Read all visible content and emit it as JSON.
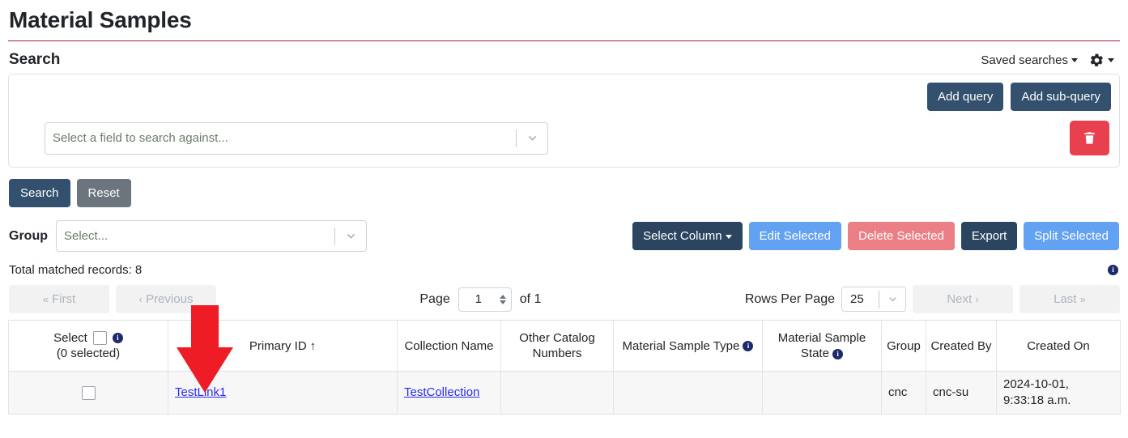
{
  "header": {
    "title": "Material Samples"
  },
  "search": {
    "heading": "Search",
    "saved_searches_label": "Saved searches",
    "gear_icon": "gear-icon",
    "add_query_label": "Add query",
    "add_subquery_label": "Add sub-query",
    "field_select_placeholder": "Select a field to search against...",
    "delete_query_icon": "trash-icon",
    "search_button": "Search",
    "reset_button": "Reset"
  },
  "group": {
    "label": "Group",
    "placeholder": "Select..."
  },
  "actions": {
    "select_column": "Select Column",
    "edit_selected": "Edit Selected",
    "delete_selected": "Delete Selected",
    "export": "Export",
    "split_selected": "Split Selected"
  },
  "results": {
    "total_text": "Total matched records: 8",
    "info_icon": "info-icon"
  },
  "pagination": {
    "first": "First",
    "previous": "Previous",
    "page_label": "Page",
    "page_value": "1",
    "of_label": "of 1",
    "rows_per_page_label": "Rows Per Page",
    "rows_per_page_value": "25",
    "next": "Next",
    "last": "Last"
  },
  "table": {
    "columns": [
      {
        "label": "Select",
        "sublabel": "(0 selected)",
        "has_checkbox": true,
        "has_info": true
      },
      {
        "label": "Primary ID",
        "sorted": "asc"
      },
      {
        "label": "Collection Name"
      },
      {
        "label": "Other Catalog Numbers"
      },
      {
        "label": "Material Sample Type",
        "has_info": true
      },
      {
        "label": "Material Sample State",
        "has_info": true
      },
      {
        "label": "Group"
      },
      {
        "label": "Created By"
      },
      {
        "label": "Created On"
      }
    ],
    "rows": [
      {
        "primary_id": "TestLink1",
        "collection_name": "TestCollection",
        "other_catalog_numbers": "",
        "material_sample_type": "",
        "material_sample_state": "",
        "group": "cnc",
        "created_by": "cnc-su",
        "created_on_line1": "2024-10-01,",
        "created_on_line2": "9:33:18 a.m."
      }
    ]
  },
  "annotation": {
    "arrow_color": "#ee1c25",
    "arrow_name": "red-pointer-arrow"
  },
  "colors": {
    "title_rule": "#a32638",
    "navy": "#33506e",
    "gray": "#6c757d",
    "blue": "#63a1f2",
    "red": "#ec7f86",
    "dark": "#2b4460",
    "danger": "#e8404f",
    "link": "#2a2af0",
    "info_badge": "#1b2a6b"
  }
}
